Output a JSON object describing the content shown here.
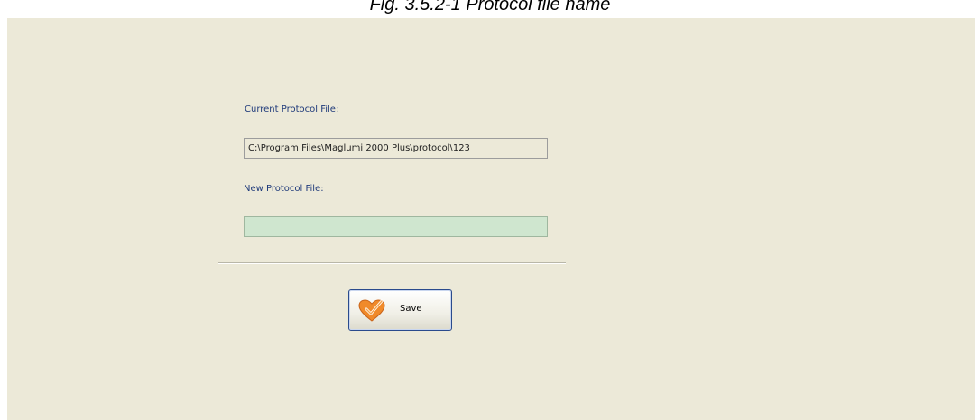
{
  "caption": "Fig. 3.5.2-1 Protocol file name",
  "form": {
    "current_label": "Current Protocol File:",
    "current_value": "C:\\Program Files\\Maglumi 2000 Plus\\protocol\\123",
    "new_label": "New Protocol File:",
    "new_value": ""
  },
  "save_button": {
    "label": "Save",
    "icon": "heart-check-icon"
  },
  "colors": {
    "panel_background": "#ece9d8",
    "label_text": "#1f3a7a",
    "new_field_background": "#cfe6cf",
    "button_border": "#2a4a8c",
    "icon_orange": "#f08a2a"
  }
}
